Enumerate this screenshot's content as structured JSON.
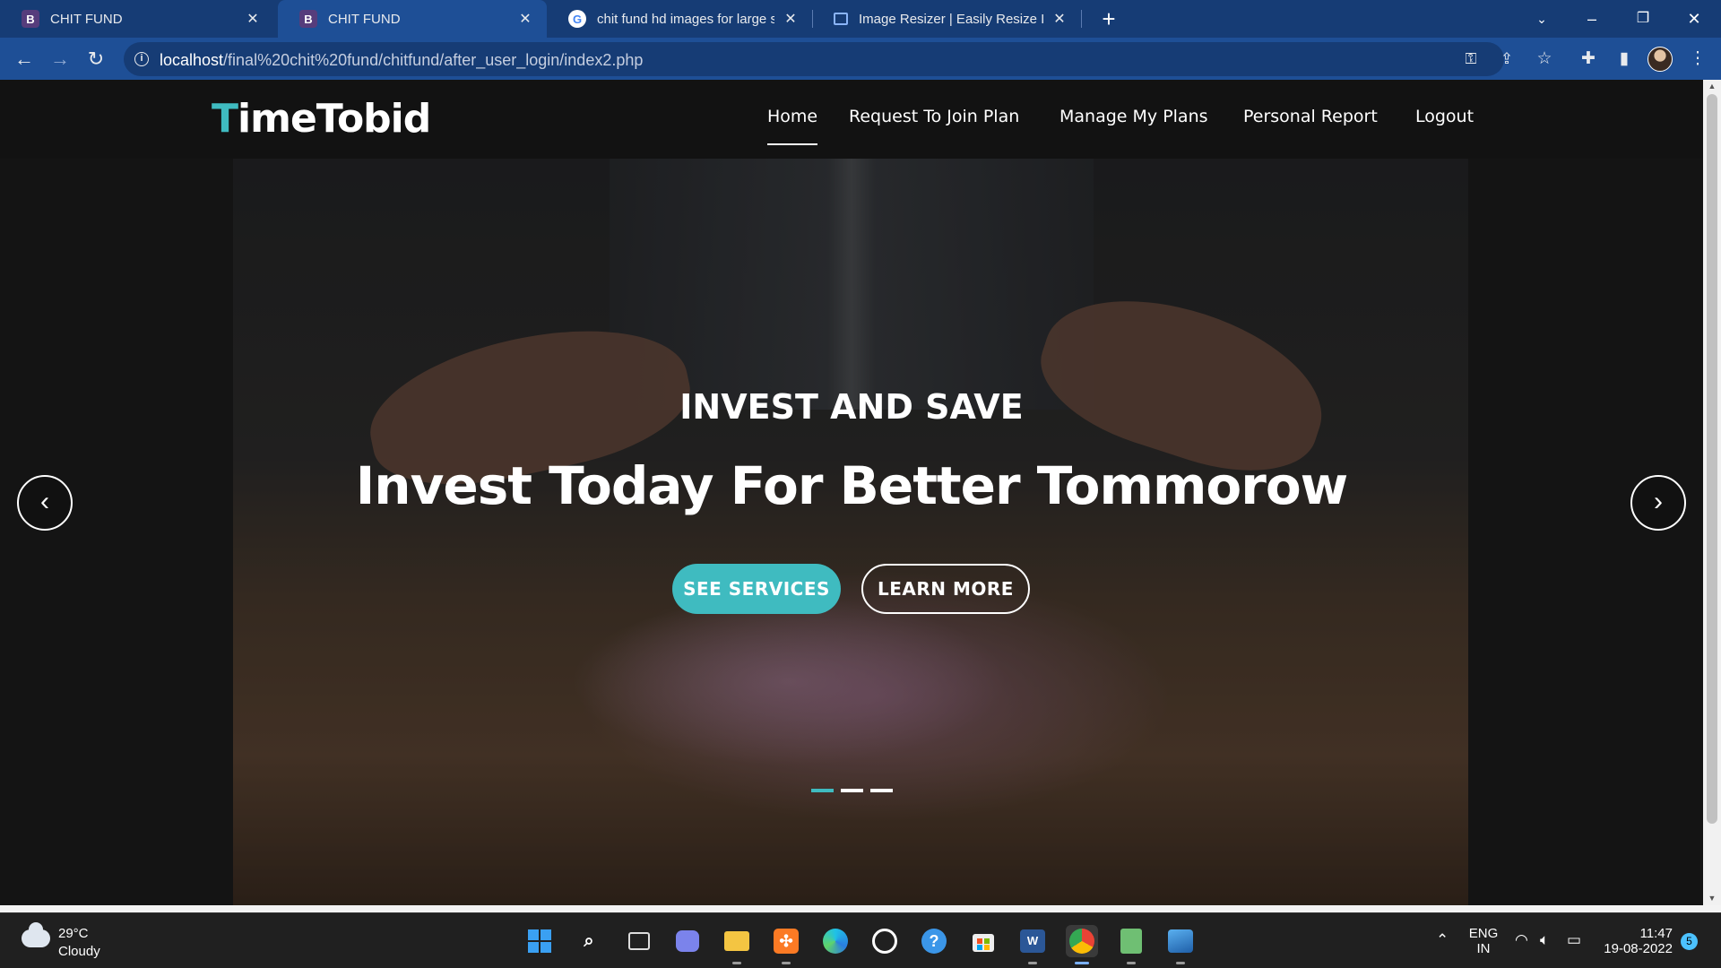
{
  "browser": {
    "tabs": [
      {
        "title": "CHIT FUND",
        "favicon": "B",
        "active": false
      },
      {
        "title": "CHIT FUND",
        "favicon": "B",
        "active": true
      },
      {
        "title": "chit fund hd images for large scr",
        "favicon": "G",
        "active": false
      },
      {
        "title": "Image Resizer | Easily Resize Imag",
        "favicon": "",
        "active": false
      }
    ],
    "new_tab": "+",
    "url_host": "localhost",
    "url_path": "/final%20chit%20fund/chitfund/after_user_login/index2.php"
  },
  "site": {
    "logo_first": "T",
    "logo_rest": "imeTobid",
    "nav": [
      "Home",
      "Request To Join Plan",
      "Manage My Plans",
      "Personal Report",
      "Logout"
    ],
    "active_nav": "Home",
    "accent_color": "#3fbbc0"
  },
  "hero": {
    "subtitle": "INVEST AND SAVE",
    "title": "Invest Today For Better Tommorow",
    "primary_button": "SEE SERVICES",
    "secondary_button": "LEARN MORE",
    "prev_icon": "chevron-left-icon",
    "next_icon": "chevron-right-icon",
    "slides": 3,
    "active_slide": 1
  },
  "taskbar": {
    "weather_temp": "29°C",
    "weather_condition": "Cloudy",
    "language": "ENG",
    "region": "IN",
    "time": "11:47",
    "date": "19-08-2022",
    "notifications": "5"
  }
}
